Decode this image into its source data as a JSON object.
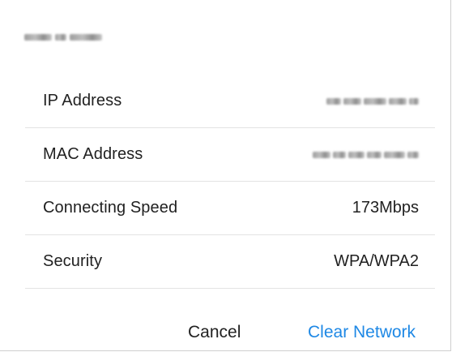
{
  "dialog": {
    "network_name_redacted": true,
    "rows": [
      {
        "label": "IP Address",
        "value": "",
        "redacted": true
      },
      {
        "label": "MAC Address",
        "value": "",
        "redacted": true
      },
      {
        "label": "Connecting Speed",
        "value": "173Mbps",
        "redacted": false
      },
      {
        "label": "Security",
        "value": "WPA/WPA2",
        "redacted": false
      }
    ],
    "actions": {
      "cancel_label": "Cancel",
      "clear_label": "Clear Network"
    },
    "colors": {
      "accent": "#1e88e5",
      "text": "#212121",
      "divider": "#e3e3e3"
    }
  }
}
